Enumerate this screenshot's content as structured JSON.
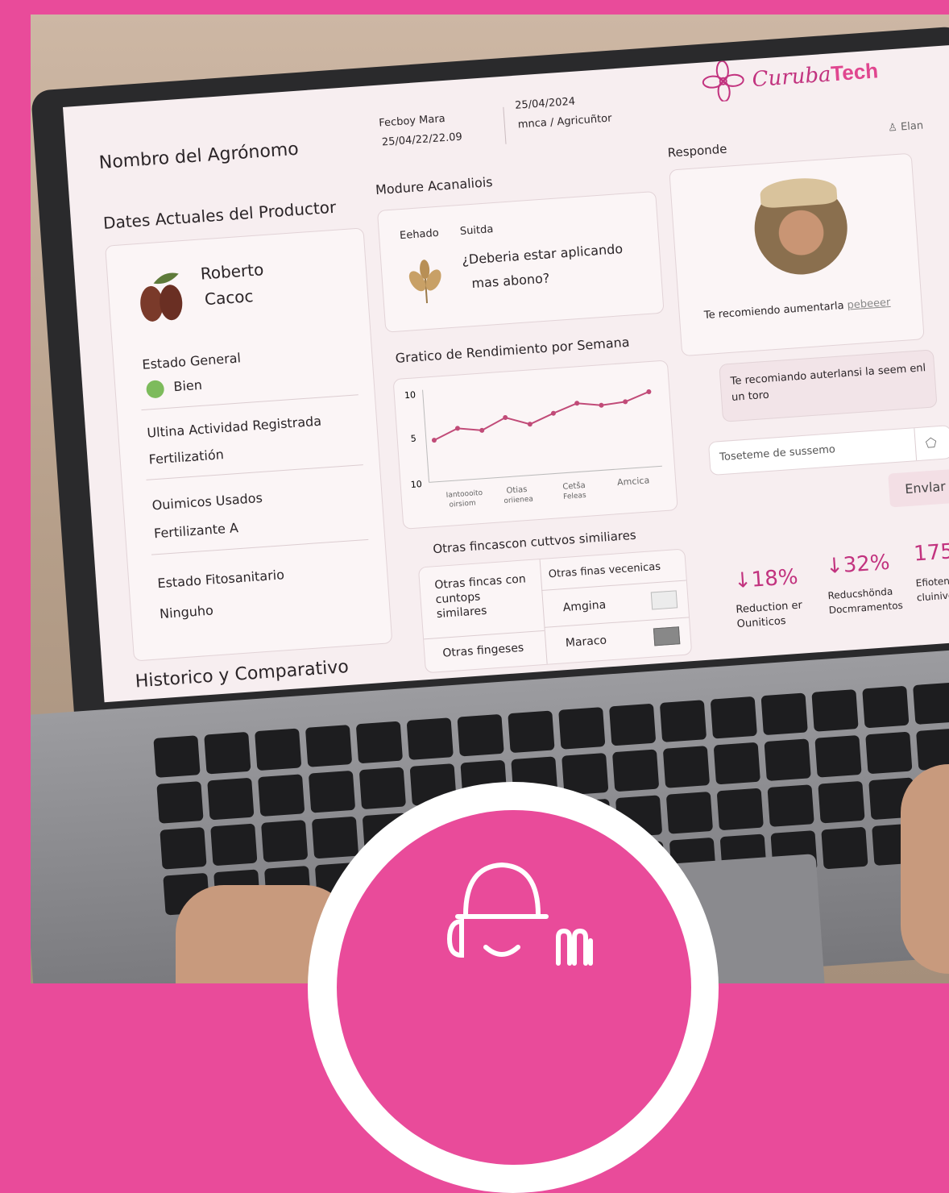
{
  "header": {
    "agronomist": "Nombro del Agrónomo",
    "meta1_line1": "Fecboy Mara",
    "meta1_line2": "25/04/22/22.09",
    "meta2_line1": "25/04/2024",
    "meta2_line2": "mnca / Agricuñtor",
    "brand_script": "Curuba",
    "brand_bold": "Tech",
    "top_right": "Elan"
  },
  "producer": {
    "section_title": "Dates Actuales del Productor",
    "name_line1": "Roberto",
    "name_line2": "Cacoc",
    "estado_label": "Estado General",
    "estado_value": "Bien",
    "actividad_label": "Ultina Actividad Registrada",
    "actividad_value": "Fertilizatión",
    "quimicos_label": "Ouimicos Usados",
    "quimicos_value": "Fertilizante A",
    "fito_label": "Estado Fitosanitario",
    "fito_value": "Ninguho"
  },
  "historico_title": "Historico y Comparativo",
  "analysis": {
    "section_title": "Modure Acanaliois",
    "tab1": "Eehado",
    "tab2": "Suitda",
    "question_line1": "¿Deberia estar aplicando",
    "question_line2": "mas abono?"
  },
  "chart_data": {
    "type": "line",
    "title": "Gratico de Rendimiento por Semana",
    "y_ticks": [
      "10",
      "5",
      "10"
    ],
    "x_labels": [
      [
        "Iantoooito",
        "oirsiom"
      ],
      [
        "Otias",
        "oriienea"
      ],
      [
        "Cetša",
        "Feleas"
      ],
      [
        "Amcica"
      ]
    ],
    "values": [
      4.5,
      5.6,
      5.2,
      6.4,
      5.5,
      6.5,
      7.4,
      7.0,
      7.2,
      8.1
    ],
    "ylim": [
      0,
      10
    ],
    "color": "#c14b78"
  },
  "similar": {
    "title": "Otras fincascon cuttvos similiares",
    "left_cell1": "Otras fincas con cuntops similares",
    "left_cell2": "Otras fingeses",
    "right_header": "Otras finas vecenicas",
    "rows": [
      "Amgina",
      "Maraco"
    ]
  },
  "response": {
    "title": "Responde",
    "recommendation": "Te recomiendo aumentarla",
    "recommendation_tail": "pebeeer",
    "bubble": "Te recomiando auterlansi la seem enl un toro",
    "input_placeholder": "Toseteme de sussemo",
    "send_label": "Envlar"
  },
  "stats": [
    {
      "value": "↓18%",
      "label": "Reduction er Ouniticos"
    },
    {
      "value": "↓32%",
      "label": "Reducshönda Docmramentos"
    },
    {
      "value": "175",
      "label": "Efiotencfu Bur cluinive"
    }
  ],
  "colors": {
    "brand_pink": "#e94b9a",
    "status_green": "#7dbb5c",
    "chart_line": "#c14b78"
  }
}
